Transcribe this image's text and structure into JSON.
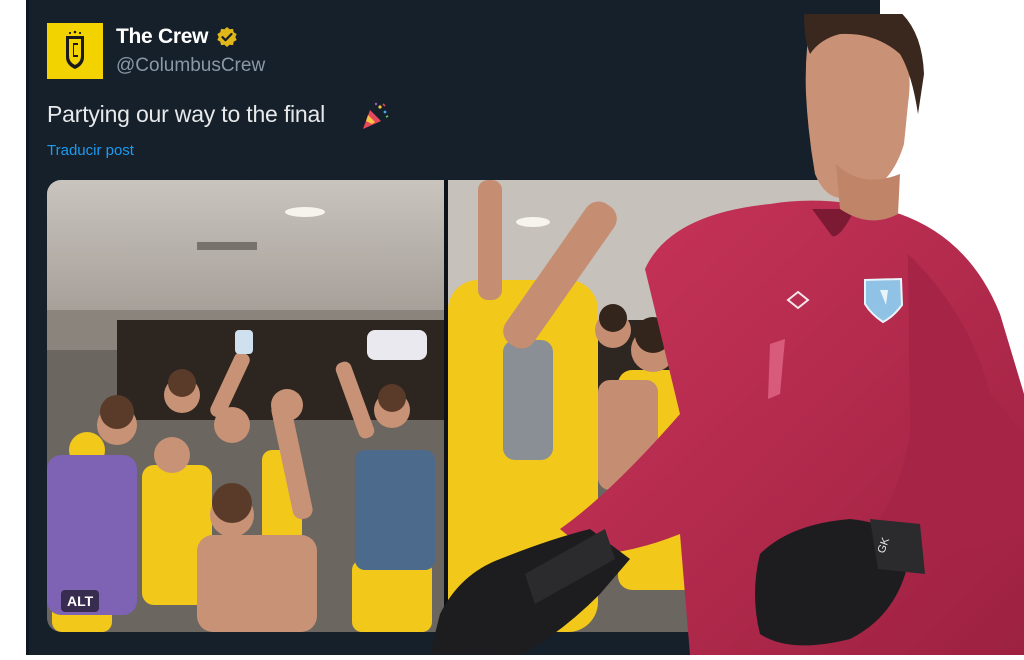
{
  "tweet": {
    "display_name": "The Crew",
    "handle": "@ColumbusCrew",
    "text": "Partying our way to the final",
    "translate_label": "Traducir post",
    "alt_label": "ALT"
  },
  "icons": {
    "avatar": "columbus-crew-crest-icon",
    "verified": "verified-badge-icon",
    "emoji": "party-popper-icon"
  },
  "colors": {
    "background": "#15202b",
    "text": "#e7e9ea",
    "secondary_text": "#8b98a5",
    "link": "#1d9bf0",
    "verified_badge": "#e2b719",
    "avatar_bg": "#f2d300",
    "jersey": "#b62a4d"
  }
}
